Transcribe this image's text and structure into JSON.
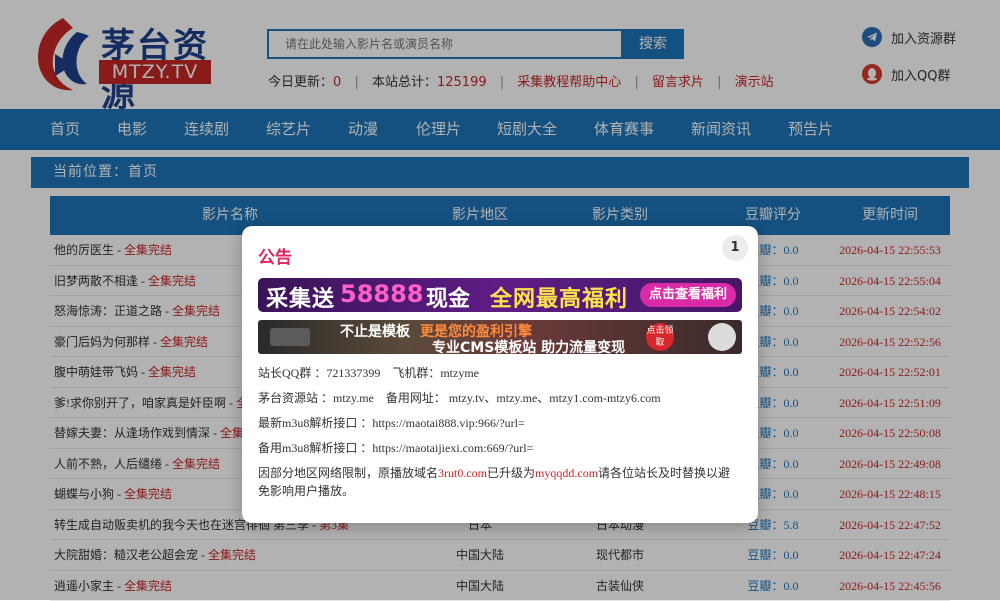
{
  "header": {
    "logo_title": "茅台资源",
    "logo_sub": "MTZY.TV",
    "search_placeholder": "请在此处输入影片名或演员名称",
    "search_button": "搜索",
    "stats": {
      "today_label": "今日更新：",
      "today_value": "0",
      "total_label": "本站总计：",
      "total_value": "125199",
      "links": [
        "采集教程帮助中心",
        "留言求片",
        "演示站"
      ]
    },
    "side_links": [
      "加入资源群",
      "加入QQ群"
    ]
  },
  "nav": [
    "首页",
    "电影",
    "连续剧",
    "综艺片",
    "动漫",
    "伦理片",
    "短剧大全",
    "体育赛事",
    "新闻资讯",
    "预告片"
  ],
  "breadcrumb": "当前位置：首页",
  "table": {
    "headers": [
      "影片名称",
      "影片地区",
      "影片类别",
      "豆瓣评分",
      "更新时间"
    ],
    "rows": [
      {
        "name": "他的厉医生",
        "status": "全集完结",
        "area": "",
        "type": "",
        "score": "豆瓣：0.0",
        "time": "2026-04-15 22:55:53"
      },
      {
        "name": "旧梦两散不相逢",
        "status": "全集完结",
        "area": "",
        "type": "",
        "score": "豆瓣：0.0",
        "time": "2026-04-15 22:55:04"
      },
      {
        "name": "怒海惊涛：正道之路",
        "status": "全集完结",
        "area": "",
        "type": "",
        "score": "豆瓣：0.0",
        "time": "2026-04-15 22:54:02"
      },
      {
        "name": "豪门后妈为何那样",
        "status": "全集完结",
        "area": "",
        "type": "",
        "score": "豆瓣：0.0",
        "time": "2026-04-15 22:52:56"
      },
      {
        "name": "腹中萌娃带飞妈",
        "status": "全集完结",
        "area": "",
        "type": "",
        "score": "豆瓣：0.0",
        "time": "2026-04-15 22:52:01"
      },
      {
        "name": "爹!求你别开了，咱家真是奸臣啊",
        "status": "全集完结",
        "area": "",
        "type": "",
        "score": "豆瓣：0.0",
        "time": "2026-04-15 22:51:09"
      },
      {
        "name": "替嫁夫妻：从逢场作戏到情深",
        "status": "全集完结",
        "area": "",
        "type": "",
        "score": "豆瓣：0.0",
        "time": "2026-04-15 22:50:08"
      },
      {
        "name": "人前不熟，人后缱绻",
        "status": "全集完结",
        "area": "",
        "type": "",
        "score": "豆瓣：0.0",
        "time": "2026-04-15 22:49:08"
      },
      {
        "name": "蝴蝶与小狗",
        "status": "全集完结",
        "area": "",
        "type": "",
        "score": "豆瓣：0.0",
        "time": "2026-04-15 22:48:15"
      },
      {
        "name": "转生成自动贩卖机的我今天也在迷宫徘徊 第三季",
        "status": "第3集",
        "area": "日本",
        "type": "日本动漫",
        "score": "豆瓣：5.8",
        "time": "2026-04-15 22:47:52"
      },
      {
        "name": "大院甜婚：糙汉老公超会宠",
        "status": "全集完结",
        "area": "中国大陆",
        "type": "现代都市",
        "score": "豆瓣：0.0",
        "time": "2026-04-15 22:47:24"
      },
      {
        "name": "逍遥小家主",
        "status": "全集完结",
        "area": "中国大陆",
        "type": "古装仙侠",
        "score": "豆瓣：0.0",
        "time": "2026-04-15 22:45:56"
      }
    ]
  },
  "modal": {
    "title": "公告",
    "badge": "1",
    "banner1": {
      "part1": "采集送",
      "number": "58888",
      "part2": "现金",
      "part3": "全网最高福利",
      "button": "点击查看福利"
    },
    "banner2": {
      "part1": "不止是模板",
      "part2": "更是您的盈利引擎",
      "part3": "专业CMS模板站 助力流量变现",
      "button": "点击领取"
    },
    "lines": {
      "qq": "站长QQ群 ：721337399　飞机群：mtzyme",
      "domains": "茅台资源站 ：mtzy.me　备用网址： mtzy.tv、mtzy.me、mtzy1.com-mtzy6.com",
      "m3u8_latest": "最新m3u8解析接口 ：https://maotai888.vip:966/?url=",
      "m3u8_backup": "备用m3u8解析接口 ：https://maotaijiexi.com:669/?url=",
      "notice_pre": "因部分地区网络限制，原播放域名",
      "notice_old": "3rut0.com",
      "notice_mid": "已升级为",
      "notice_new": "myqqdd.com",
      "notice_post": "请各位站长及时替换以避免影响用户播放。"
    }
  },
  "colors": {
    "primary_blue": "#1e74b8",
    "accent_red": "#c62828",
    "title_pink": "#e0245e"
  }
}
